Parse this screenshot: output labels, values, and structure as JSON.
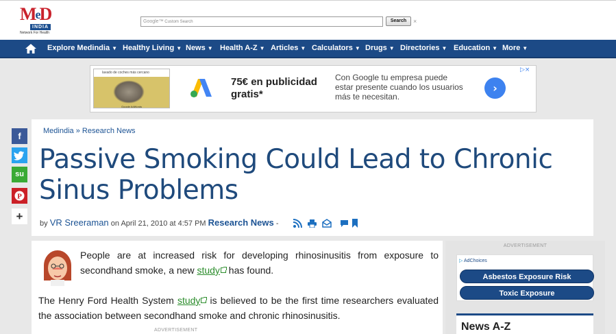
{
  "header": {
    "logo": {
      "text": "MeD",
      "sub": "INDIA",
      "tagline": "Network For Health"
    },
    "search": {
      "placeholder": "Custom Search",
      "google": "Google™",
      "button": "Search",
      "clear": "×"
    }
  },
  "nav": {
    "items": [
      {
        "label": "Explore Medindia"
      },
      {
        "label": "Healthy Living"
      },
      {
        "label": "News"
      },
      {
        "label": "Health A-Z"
      },
      {
        "label": "Articles"
      },
      {
        "label": "Calculators"
      },
      {
        "label": "Drugs"
      },
      {
        "label": "Directories"
      },
      {
        "label": "Education"
      },
      {
        "label": "More"
      }
    ],
    "caret": "▼"
  },
  "ad_banner": {
    "thumb_search": "lavado de coches más cercano",
    "thumb_label": "Google AdWords",
    "headline_1": "75€ en publicidad",
    "headline_2": "gratis*",
    "body": "Con Google tu empresa puede estar presente cuando los usuarios más te necesitan.",
    "arrow": "›",
    "close": "▷×"
  },
  "share": [
    {
      "icon": "facebook-icon",
      "glyph": "f",
      "color": "#3b5998"
    },
    {
      "icon": "twitter-icon",
      "glyph": "t",
      "color": "#2aa3ef"
    },
    {
      "icon": "stumbleupon-icon",
      "glyph": "su",
      "color": "#3aaa35"
    },
    {
      "icon": "pinterest-icon",
      "glyph": "P",
      "color": "#cb2027"
    },
    {
      "icon": "plus-icon",
      "glyph": "+",
      "color": "#ffffff"
    }
  ],
  "article": {
    "breadcrumb": {
      "home": "Medindia",
      "sep": "»",
      "section": "Research News"
    },
    "title": "Passive Smoking Could Lead to Chronic Sinus Problems",
    "byline": {
      "by": "by",
      "author": "VR Sreeraman",
      "on": "on",
      "date": "April 21, 2010 at 4:57 PM",
      "category": "Research News",
      "dash": "-"
    },
    "p1_before": "People are at increased risk for developing rhinosinusitis from exposure to secondhand smoke, a new ",
    "p1_link": "study",
    "p1_after": " has found.",
    "p2_before": "The Henry Ford Health System ",
    "p2_link": "study",
    "p2_after": " is believed to be the first time researchers evaluated the association between secondhand smoke and chronic rhinosinusitis.",
    "advertisement": "ADVERTISEMENT"
  },
  "sidebar": {
    "advertisement": "ADVERTISEMENT",
    "adchoices": "AdChoices",
    "links": [
      "Asbestos Exposure Risk",
      "Toxic Exposure"
    ],
    "news_heading": "News A-Z"
  },
  "colors": {
    "brand_blue": "#1c4a86",
    "title_blue": "#1f4a7c",
    "link_green": "#2a8c2a",
    "logo_red": "#c9232d"
  }
}
